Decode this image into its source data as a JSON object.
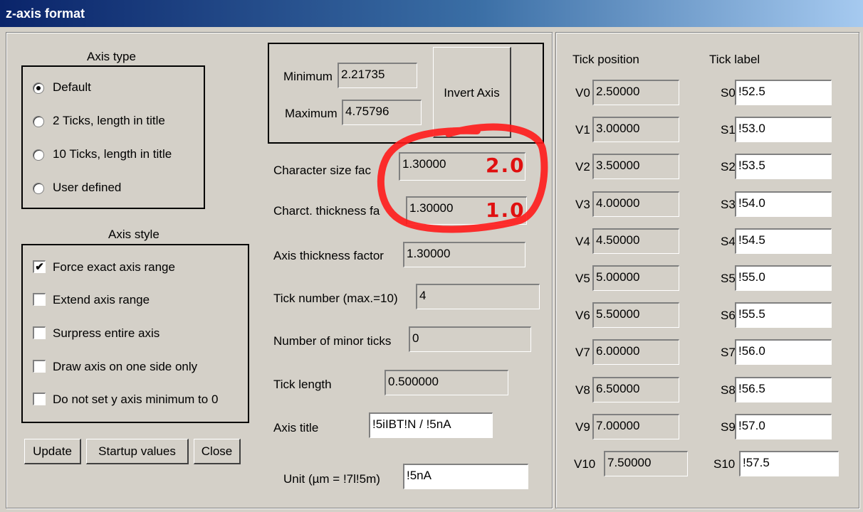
{
  "window": {
    "title": "z-axis format"
  },
  "axis_type": {
    "heading": "Axis type",
    "options": [
      {
        "label": "Default",
        "selected": true
      },
      {
        "label": "2 Ticks, length in title",
        "selected": false
      },
      {
        "label": "10 Ticks, length in title",
        "selected": false
      },
      {
        "label": "User defined",
        "selected": false
      }
    ]
  },
  "axis_style": {
    "heading": "Axis style",
    "options": [
      {
        "label": "Force exact axis range",
        "checked": true,
        "mark": "✔"
      },
      {
        "label": "Extend axis range",
        "checked": false,
        "mark": ""
      },
      {
        "label": "Surpress entire axis",
        "checked": false,
        "mark": ""
      },
      {
        "label": "Draw axis on one side only",
        "checked": false,
        "mark": ""
      },
      {
        "label": "Do not set y axis minimum to 0",
        "checked": false,
        "mark": ""
      }
    ]
  },
  "buttons": {
    "update": "Update",
    "startup": "Startup values",
    "close": "Close"
  },
  "range": {
    "min_label": "Minimum",
    "min_value": "2.21735",
    "max_label": "Maximum",
    "max_value": "4.75796",
    "invert_label": "Invert Axis"
  },
  "params": {
    "char_size_label": "Character size fac",
    "char_size_value": "1.30000",
    "char_thick_label": "Charct. thickness fa",
    "char_thick_value": "1.30000",
    "axis_thick_label": "Axis thickness factor",
    "axis_thick_value": "1.30000",
    "tick_number_label": "Tick number (max.=10)",
    "tick_number_value": "4",
    "minor_ticks_label": "Number of minor ticks",
    "minor_ticks_value": "0",
    "tick_length_label": "Tick length",
    "tick_length_value": "0.500000",
    "axis_title_label": "Axis title",
    "axis_title_value": "!5iIBT!N / !5nA",
    "unit_label": "Unit (µm = !7l!5m)",
    "unit_value": "!5nA"
  },
  "annotations": {
    "char_size_new": "2.0",
    "char_thick_new": "1.0",
    "highlight_color": "#ff1a1a"
  },
  "ticks": {
    "position_heading": "Tick position",
    "label_heading": "Tick label",
    "rows": [
      {
        "v": "V0",
        "pos": "2.50000",
        "s": "S0",
        "label": "!52.5"
      },
      {
        "v": "V1",
        "pos": "3.00000",
        "s": "S1",
        "label": "!53.0"
      },
      {
        "v": "V2",
        "pos": "3.50000",
        "s": "S2",
        "label": "!53.5"
      },
      {
        "v": "V3",
        "pos": "4.00000",
        "s": "S3",
        "label": "!54.0"
      },
      {
        "v": "V4",
        "pos": "4.50000",
        "s": "S4",
        "label": "!54.5"
      },
      {
        "v": "V5",
        "pos": "5.00000",
        "s": "S5",
        "label": "!55.0"
      },
      {
        "v": "V6",
        "pos": "5.50000",
        "s": "S6",
        "label": "!55.5"
      },
      {
        "v": "V7",
        "pos": "6.00000",
        "s": "S7",
        "label": "!56.0"
      },
      {
        "v": "V8",
        "pos": "6.50000",
        "s": "S8",
        "label": "!56.5"
      },
      {
        "v": "V9",
        "pos": "7.00000",
        "s": "S9",
        "label": "!57.0"
      },
      {
        "v": "V10",
        "pos": "7.50000",
        "s": "S10",
        "label": "!57.5"
      }
    ]
  }
}
